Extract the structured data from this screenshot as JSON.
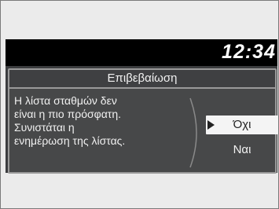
{
  "status_bar": {
    "clock": "12:34"
  },
  "dialog": {
    "title": "Επιβεβαίωση",
    "message_lines": [
      "Η λίστα σταθμών δεν",
      "είναι η πιο πρόσφατη.",
      "Συνιστάται η",
      "ενημέρωση της λίστας."
    ],
    "options": {
      "no_label": "Όχι",
      "yes_label": "Ναι",
      "selected": "no"
    }
  },
  "colors": {
    "screen_bg": "#3c3d3f",
    "status_bar_bg": "#000000",
    "highlight_bg": "#f4f4f4",
    "text": "#f0f0f0"
  },
  "icons": {
    "selection_cursor": "triangle-right-icon"
  }
}
